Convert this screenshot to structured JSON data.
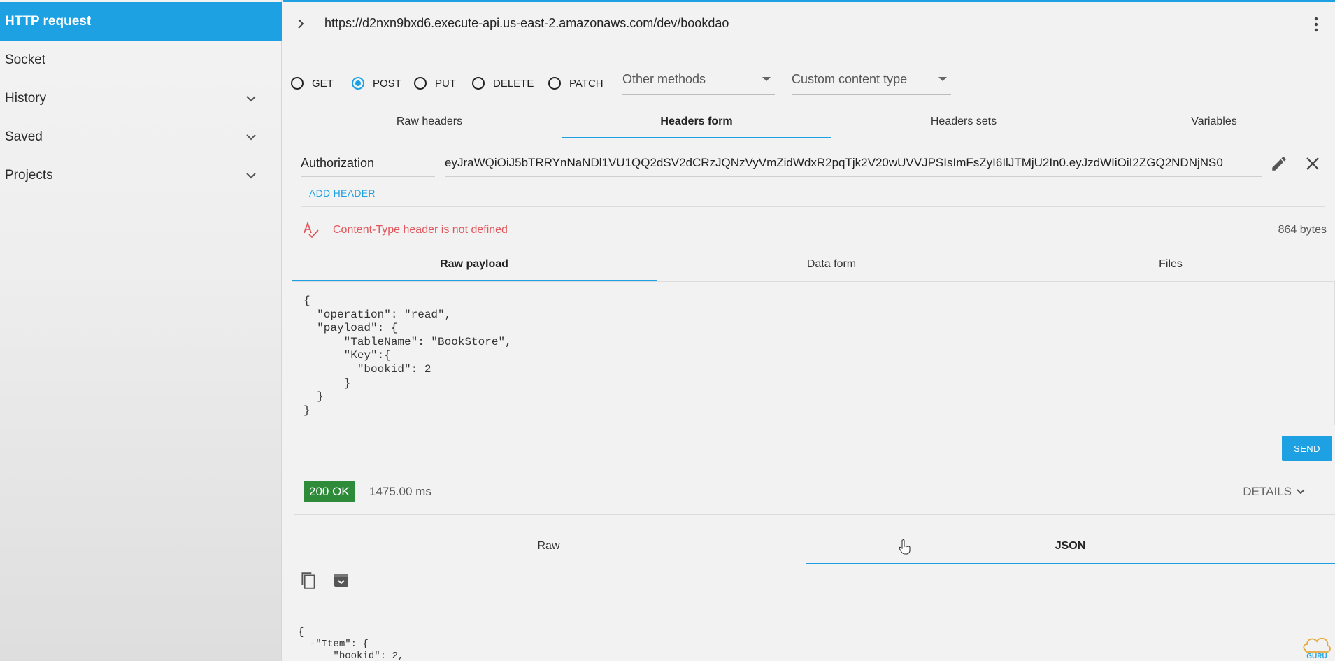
{
  "sidebar": {
    "items": [
      {
        "label": "HTTP request",
        "active": true
      },
      {
        "label": "Socket"
      },
      {
        "label": "History",
        "expandable": true
      },
      {
        "label": "Saved",
        "expandable": true
      },
      {
        "label": "Projects",
        "expandable": true
      }
    ]
  },
  "request": {
    "url": "https://d2nxn9bxd6.execute-api.us-east-2.amazonaws.com/dev/bookdao",
    "methods": [
      "GET",
      "POST",
      "PUT",
      "DELETE",
      "PATCH"
    ],
    "selected_method": "POST",
    "other_methods_label": "Other methods",
    "content_type_label": "Custom content type"
  },
  "header_tabs": [
    "Raw headers",
    "Headers form",
    "Headers sets",
    "Variables"
  ],
  "header_tabs_active": "Headers form",
  "header": {
    "name": "Authorization",
    "value": "eyJraWQiOiJ5bTRRYnNaNDl1VU1QQ2dSV2dCRzJQNzVyVmZidWdxR2pqTjk2V20wUVVJPSIsImFsZyI6IlJTMjU2In0.eyJzdWIiOiI2ZGQ2NDNjNS0",
    "add_label": "ADD HEADER"
  },
  "warning": {
    "text": "Content-Type header is not defined",
    "size": "864 bytes"
  },
  "body_tabs": [
    "Raw payload",
    "Data form",
    "Files"
  ],
  "body_tabs_active": "Raw payload",
  "payload": "{\n  \"operation\": \"read\",\n  \"payload\": {\n      \"TableName\": \"BookStore\",\n      \"Key\":{\n        \"bookid\": 2\n      }\n  }\n}",
  "send_label": "SEND",
  "response": {
    "status": "200 OK",
    "time": "1475.00 ms",
    "details_label": "DETAILS",
    "tabs": [
      "Raw",
      "JSON"
    ],
    "tabs_active": "JSON",
    "json_lines": [
      "{",
      "  -\"Item\": {",
      "      \"bookid\": 2,"
    ]
  },
  "logo_text": "GURU",
  "colors": {
    "accent": "#1ea1e3",
    "status_ok": "#2e8b3a",
    "warning": "#e0575d"
  }
}
